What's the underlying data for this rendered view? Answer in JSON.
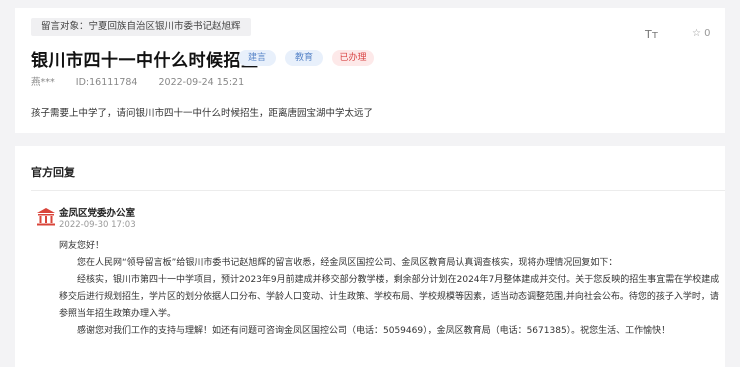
{
  "message": {
    "target": "留言对象：宁夏回族自治区银川市委书记赵旭辉",
    "title": "银川市四十一中什么时候招生",
    "badges": [
      "建言",
      "教育",
      "已办理"
    ],
    "font_size_label": "Tт",
    "favorite_label": "☆ 0",
    "author": "燕***",
    "id_text": "ID:16111784",
    "datetime": "2022-09-24 15:21",
    "content": "孩子需要上中学了，请问银川市四十一中什么时候招生，距离唐园宝湖中学太远了"
  },
  "reply": {
    "heading": "官方回复",
    "department": "金凤区党委办公室",
    "date": "2022-09-30 17:03",
    "greeting": "网友您好！",
    "paragraph1": "您在人民网“领导留言板”给银川市委书记赵旭辉的留言收悉，经金凤区国控公司、金凤区教育局认真调查核实，现将办理情况回复如下：",
    "paragraph2": "经核实，银川市第四十一中学项目，预计2023年9月前建成并移交部分教学楼，剩余部分计划在2024年7月整体建成并交付。关于您反映的招生事宜需在学校建成移交后进行规划招生，学片区的划分依据人口分布、学龄人口变动、计生政策、学校布局、学校规模等因素，适当动态调整范围,并向社会公布。待您的孩子入学时，请参照当年招生政策办理入学。",
    "paragraph3": "感谢您对我们工作的支持与理解！如还有问题可咨询金凤区国控公司（电话：5059469），金凤区教育局（电话：5671385）。祝您生活、工作愉快！"
  },
  "colors": {
    "badge_blue_text": "#5b87c9",
    "badge_blue_bg": "#e8f0fb",
    "badge_red_text": "#d94646",
    "badge_red_bg": "#fde9e9",
    "dept_icon": "#d9443a"
  }
}
